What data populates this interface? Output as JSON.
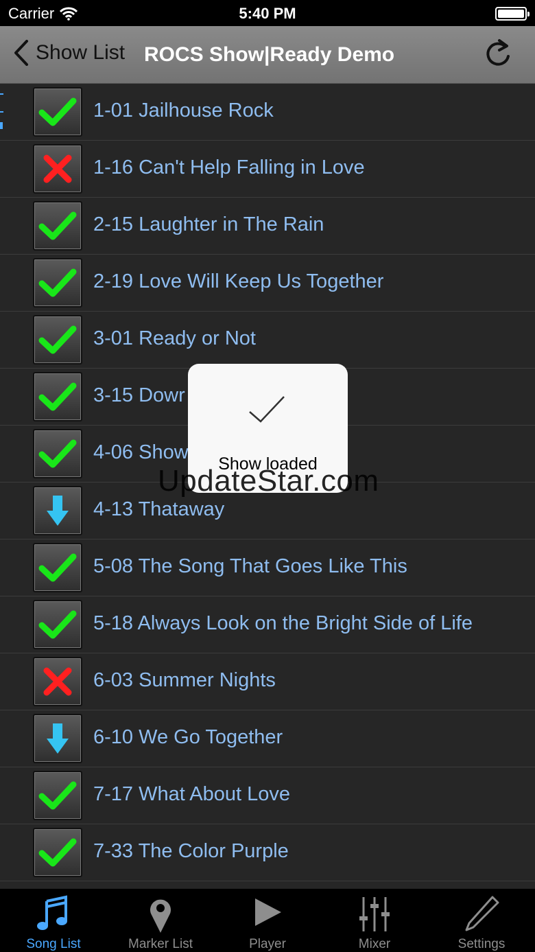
{
  "status_bar": {
    "carrier": "Carrier",
    "time": "5:40 PM",
    "battery_percent": 100
  },
  "nav": {
    "back_label": "Show List",
    "title": "ROCS Show|Ready Demo"
  },
  "songs": [
    {
      "label": "1-01 Jailhouse Rock",
      "status": "ready"
    },
    {
      "label": "1-16 Can't Help Falling in Love",
      "status": "missing"
    },
    {
      "label": "2-15 Laughter in The Rain",
      "status": "ready"
    },
    {
      "label": "2-19 Love Will Keep Us Together",
      "status": "ready"
    },
    {
      "label": "3-01 Ready or Not",
      "status": "ready"
    },
    {
      "label": "3-15 Dowr",
      "status": "ready"
    },
    {
      "label": "4-06 Show",
      "status": "ready"
    },
    {
      "label": "4-13 Thataway",
      "status": "download"
    },
    {
      "label": "5-08 The Song That Goes Like This",
      "status": "ready"
    },
    {
      "label": "5-18 Always Look on the Bright Side of Life",
      "status": "ready"
    },
    {
      "label": "6-03 Summer Nights",
      "status": "missing"
    },
    {
      "label": "6-10 We Go Together",
      "status": "download"
    },
    {
      "label": "7-17 What About Love",
      "status": "ready"
    },
    {
      "label": "7-33 The Color Purple",
      "status": "ready"
    }
  ],
  "hud": {
    "message": "Show loaded"
  },
  "watermark": {
    "text": "UpdateStar.com"
  },
  "tabs": [
    {
      "label": "Song List",
      "icon": "music-note-icon",
      "active": true
    },
    {
      "label": "Marker List",
      "icon": "map-pin-icon",
      "active": false
    },
    {
      "label": "Player",
      "icon": "play-icon",
      "active": false
    },
    {
      "label": "Mixer",
      "icon": "sliders-icon",
      "active": false
    },
    {
      "label": "Settings",
      "icon": "pencil-icon",
      "active": false
    }
  ],
  "colors": {
    "song_text": "#8fbdf0",
    "ready": "#19e619",
    "missing": "#ff2020",
    "download": "#35c4f2",
    "tab_active": "#4aa8ff",
    "tab_inactive": "#8e8e8e"
  }
}
